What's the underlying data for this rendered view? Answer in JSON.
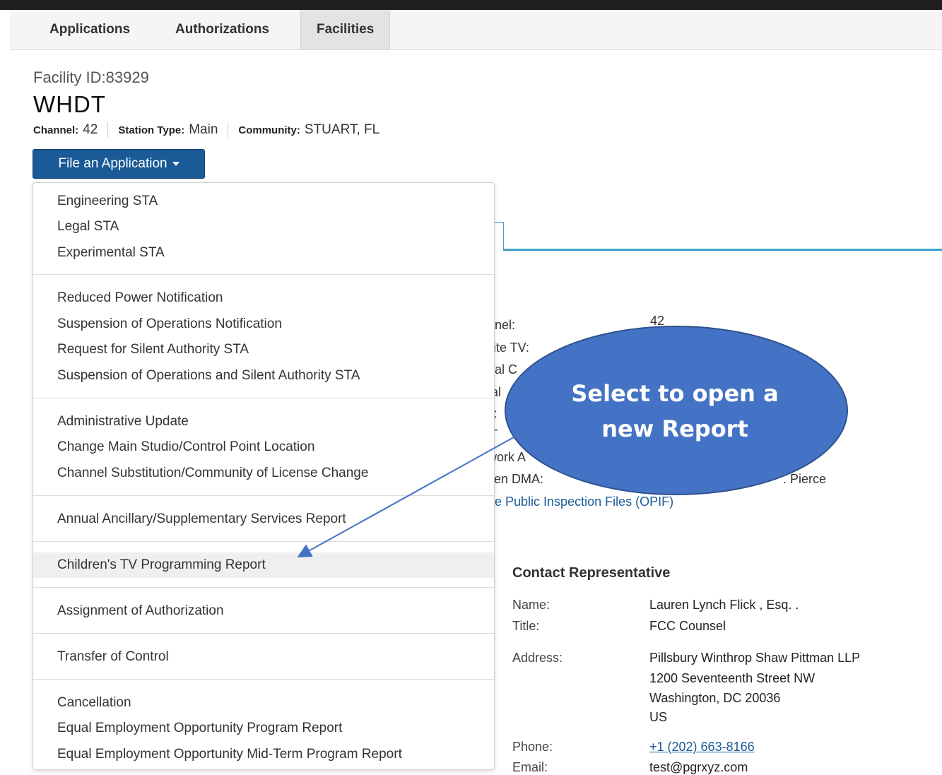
{
  "nav": {
    "tabs": [
      {
        "label": "Applications"
      },
      {
        "label": "Authorizations"
      },
      {
        "label": "Facilities"
      }
    ]
  },
  "facility": {
    "id_text": "Facility ID:83929",
    "call_sign": "WHDT",
    "channel_label": "Channel:",
    "channel": "42",
    "station_type_label": "Station Type:",
    "station_type": "Main",
    "community_label": "Community:",
    "community": "STUART, FL"
  },
  "file_button": {
    "label": "File an Application"
  },
  "menu": {
    "groups": [
      [
        "Engineering STA",
        "Legal STA",
        "Experimental STA"
      ],
      [
        "Reduced Power Notification",
        "Suspension of Operations Notification",
        "Request for Silent Authority STA",
        "Suspension of Operations and Silent Authority STA"
      ],
      [
        "Administrative Update",
        "Change Main Studio/Control Point Location",
        "Channel Substitution/Community of License Change"
      ],
      [
        "Annual Ancillary/Supplementary Services Report"
      ],
      [
        "Children's TV Programming Report"
      ],
      [
        "Assignment of Authorization"
      ],
      [
        "Transfer of Control"
      ],
      [
        "Cancellation",
        "Equal Employment Opportunity Program Report",
        "Equal Employment Opportunity Mid-Term Program Report"
      ]
    ],
    "highlighted": "Children's TV Programming Report"
  },
  "background_details": {
    "labels": [
      "nnel:",
      "llite TV:",
      "ual C",
      "tal",
      "C",
      "'T",
      "work A",
      "sen DMA:"
    ],
    "value_fragments": [
      "42",
      ". Pierce"
    ],
    "opif_link": "ne Public Inspection Files (OPIF)"
  },
  "contact": {
    "heading": "Contact Representative",
    "name_label": "Name:",
    "name": "Lauren Lynch Flick , Esq. .",
    "title_label": "Title:",
    "title": "FCC Counsel",
    "address_label": "Address:",
    "address_lines": [
      "Pillsbury Winthrop Shaw Pittman LLP",
      "1200 Seventeenth Street NW",
      "Washington, DC 20036",
      "US"
    ],
    "phone_label": "Phone:",
    "phone": "+1 (202) 663-8166",
    "email_label": "Email:",
    "email": "test@pgrxyz.com"
  },
  "callout": {
    "lines": [
      "Select to open a",
      "new Report"
    ],
    "fill_color": "#4472c4",
    "stroke_color": "#2f528f"
  },
  "colors": {
    "primary_button": "#1a5a96",
    "link": "#1a5a96",
    "accent_line": "#3aa0c8"
  }
}
